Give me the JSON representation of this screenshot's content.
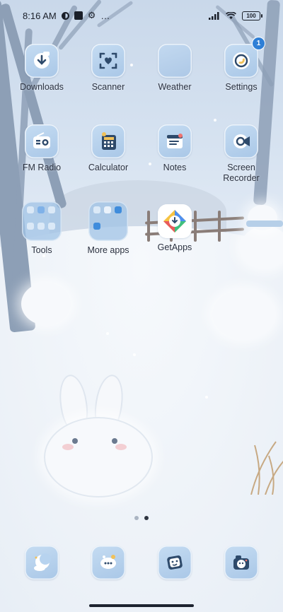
{
  "status_bar": {
    "time": "8:16 AM",
    "more": "…",
    "battery": "100"
  },
  "apps": [
    {
      "label": "Downloads"
    },
    {
      "label": "Scanner"
    },
    {
      "label": "Weather"
    },
    {
      "label": "Settings",
      "badge": "1"
    },
    {
      "label": "FM Radio"
    },
    {
      "label": "Calculator"
    },
    {
      "label": "Notes"
    },
    {
      "label": "Screen Recorder"
    },
    {
      "label": "Tools"
    },
    {
      "label": "More apps"
    },
    {
      "label": "GetApps"
    }
  ],
  "page_indicator": {
    "pages": 2,
    "current_page": 2
  },
  "dock": [
    {
      "icon": "moon-cloud-icon"
    },
    {
      "icon": "chat-bubbles-icon"
    },
    {
      "icon": "gallery-icon"
    },
    {
      "icon": "camera-icon"
    }
  ],
  "colors": {
    "accent": "#2f7fd6",
    "icon_bg": "#b7d3ef",
    "icon_glyph": "#2e4a6b"
  }
}
